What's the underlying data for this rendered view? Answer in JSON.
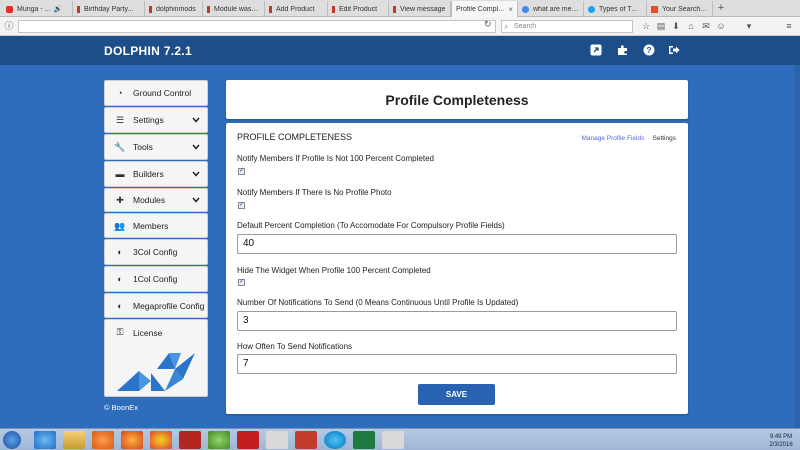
{
  "browser": {
    "tabs": [
      {
        "label": "Munga - ...",
        "icon": "youtube-icon",
        "color": "#e52d27"
      },
      {
        "label": "Birthday Party...",
        "icon": "page-icon",
        "color": "#c0392b"
      },
      {
        "label": "dolphinmods",
        "icon": "page-icon",
        "color": "#c0392b"
      },
      {
        "label": "Module was n...",
        "icon": "page-icon",
        "color": "#c0392b"
      },
      {
        "label": "Add Product",
        "icon": "page-icon",
        "color": "#c0392b"
      },
      {
        "label": "Edit Product",
        "icon": "page-icon",
        "color": "#c0392b"
      },
      {
        "label": "View message",
        "icon": "page-icon",
        "color": "#c0392b"
      },
      {
        "label": "Profile Comple...",
        "icon": "page-icon",
        "color": "#c0392b"
      },
      {
        "label": "what are men...",
        "icon": "google-icon",
        "color": "#4285f4"
      },
      {
        "label": "Types of Twe...",
        "icon": "twitter-icon",
        "color": "#1da1f2"
      },
      {
        "label": "Your Search R...",
        "icon": "page-icon",
        "color": "#e8501f"
      }
    ],
    "active_tab": 7,
    "new_tab_label": "+",
    "reload_glyph": "↻",
    "search_placeholder": "Search",
    "toolbar_icons": [
      "star-icon",
      "reading-list-icon",
      "download-icon",
      "home-icon",
      "chat-icon",
      "emoji-icon",
      "bookmark-icon",
      "menu-icon"
    ]
  },
  "header": {
    "brand": "DOLPHIN 7.2.1",
    "icons": [
      "external-link-icon",
      "puzzle-icon",
      "help-icon",
      "logout-icon"
    ]
  },
  "sidebar": {
    "items": [
      {
        "label": "Ground Control",
        "icon": "dashboard-icon",
        "has_chevron": false
      },
      {
        "label": "Settings",
        "icon": "sliders-icon",
        "has_chevron": true
      },
      {
        "label": "Tools",
        "icon": "wrench-icon",
        "has_chevron": true
      },
      {
        "label": "Builders",
        "icon": "paint-roller-icon",
        "has_chevron": true
      },
      {
        "label": "Modules",
        "icon": "puzzle-icon",
        "has_chevron": true
      },
      {
        "label": "Members",
        "icon": "users-icon",
        "has_chevron": false
      },
      {
        "label": "3Col Config",
        "icon": "module-icon",
        "has_chevron": false
      },
      {
        "label": "1Col Config",
        "icon": "module-icon",
        "has_chevron": false
      },
      {
        "label": "Megaprofile Config",
        "icon": "module-icon",
        "has_chevron": false
      },
      {
        "label": "License",
        "icon": "key-icon",
        "has_chevron": false
      }
    ],
    "chevron_glyph": "⌄",
    "copyright": "© BoonEx"
  },
  "page": {
    "title": "Profile Completeness",
    "section_title": "PROFILE COMPLETENESS",
    "links": {
      "manage": "Manage Profile Fields",
      "settings": "Settings"
    },
    "fields": [
      {
        "label": "Notify Members If Profile Is Not 100 Percent Completed",
        "type": "checkbox",
        "checked": true
      },
      {
        "label": "Notify Members If There Is No Profile Photo",
        "type": "checkbox",
        "checked": true
      },
      {
        "label": "Default Percent Completion (To Accomodate For Compulsory Profile Fields)",
        "type": "text",
        "value": "40"
      },
      {
        "label": "Hide The Widget When Profile 100 Percent Completed",
        "type": "checkbox",
        "checked": true
      },
      {
        "label": "Number Of Notifications To Send (0 Means Continuous Until Profile Is Updated)",
        "type": "text",
        "value": "3"
      },
      {
        "label": "How Often To Send Notifications",
        "type": "text",
        "value": "7"
      }
    ],
    "save_label": "SAVE"
  },
  "taskbar": {
    "clock_time": "9:49 PM",
    "clock_date": "2/3/2016"
  },
  "colors": {
    "page_bg": "#2e6dbc",
    "header_bg": "#1d4e8a",
    "accent": "#2862b0",
    "link": "#5b63d6"
  }
}
